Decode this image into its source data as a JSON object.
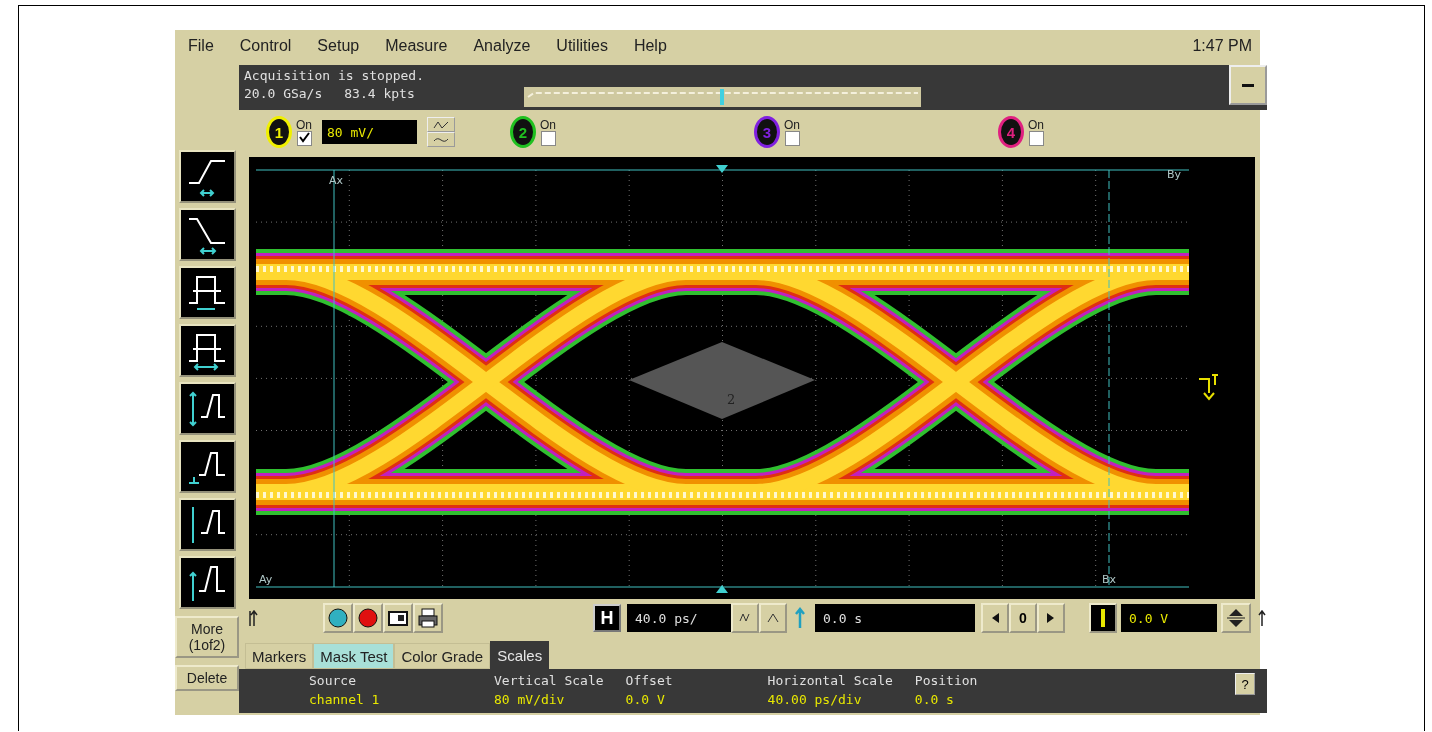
{
  "menu": [
    {
      "label": "File"
    },
    {
      "label": "Control"
    },
    {
      "label": "Setup"
    },
    {
      "label": "Measure"
    },
    {
      "label": "Analyze"
    },
    {
      "label": "Utilities"
    },
    {
      "label": "Help"
    }
  ],
  "clock": "1:47 PM",
  "acquisition": {
    "status": "Acquisition is stopped.",
    "rate": "20.0 GSa/s",
    "points": "83.4 kpts"
  },
  "channels": [
    {
      "number": "1",
      "color": "#f0f000",
      "on_label": "On",
      "on": true,
      "scale": "80 mV/"
    },
    {
      "number": "2",
      "color": "#20c020",
      "on_label": "On",
      "on": false
    },
    {
      "number": "3",
      "color": "#8020e0",
      "on_label": "On",
      "on": false
    },
    {
      "number": "4",
      "color": "#e02080",
      "on_label": "On",
      "on": false
    }
  ],
  "side_buttons": [
    "More (1of2)",
    "Delete"
  ],
  "plot": {
    "cursor_labels": [
      "Ax",
      "By",
      "Ay",
      "Bx"
    ],
    "mask_label": "2"
  },
  "controls": {
    "horizontal_label": "H",
    "timebase": "40.0 ps/",
    "delay": "0.0 s",
    "delay_zero": "0",
    "trigger_level": "0.0 V"
  },
  "tabs": [
    {
      "label": "Markers",
      "selected": false,
      "highlighted": false
    },
    {
      "label": "Mask Test",
      "selected": false,
      "highlighted": true
    },
    {
      "label": "Color Grade",
      "selected": false,
      "highlighted": false
    },
    {
      "label": "Scales",
      "selected": true,
      "highlighted": false
    }
  ],
  "status": [
    {
      "label": "Source",
      "value": "channel 1"
    },
    {
      "label": "Vertical Scale",
      "value": "80 mV/div"
    },
    {
      "label": "Offset",
      "value": "0.0 V"
    },
    {
      "label": "Horizontal Scale",
      "value": "40.00 ps/div"
    },
    {
      "label": "Position",
      "value": "0.0 s"
    }
  ],
  "help": "?"
}
